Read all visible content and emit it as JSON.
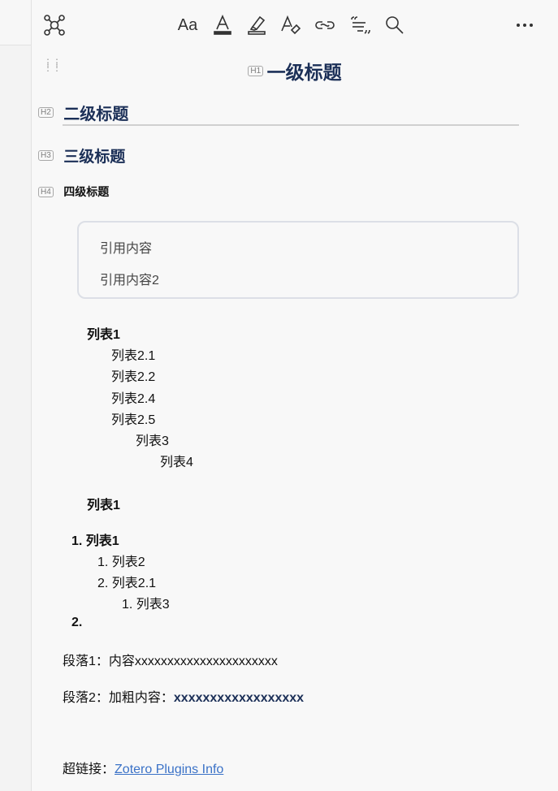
{
  "toolbar": {
    "icons": [
      "graph-icon",
      "font-size-icon",
      "text-color-icon",
      "highlight-icon",
      "clear-format-icon",
      "link-icon",
      "citation-icon",
      "search-icon",
      "more-icon"
    ],
    "font_label": "Aa"
  },
  "headings": {
    "h1": {
      "badge": "H1",
      "text": "一级标题"
    },
    "h2": {
      "badge": "H2",
      "text": "二级标题"
    },
    "h3": {
      "badge": "H3",
      "text": "三级标题"
    },
    "h4": {
      "badge": "H4",
      "text": "四级标题"
    }
  },
  "quote": {
    "lines": [
      "引用内容",
      "引用内容2"
    ]
  },
  "bullets": {
    "item1": "列表1",
    "item2_1": "列表2.1",
    "item2_2": "列表2.2",
    "item2_4": "列表2.4",
    "item2_5": "列表2.5",
    "item3": "列表3",
    "item4": "列表4",
    "item1b": "列表1"
  },
  "ordered": {
    "n1": "1.",
    "item1": "列表1",
    "n1a": "1.",
    "item2": "列表2",
    "n2a": "2.",
    "item2_1": "列表2.1",
    "n1b": "1.",
    "item3": "列表3",
    "n2": "2."
  },
  "paragraphs": {
    "p1_label": "段落1：内容",
    "p1_value": "xxxxxxxxxxxxxxxxxxxxxx",
    "p2_label": "段落2：加粗内容：",
    "p2_value": "xxxxxxxxxxxxxxxxxx",
    "link_label": "超链接：",
    "link_text": "Zotero Plugins Info"
  },
  "colors": {
    "heading": "#1b2f57",
    "link": "#3b72c7"
  }
}
